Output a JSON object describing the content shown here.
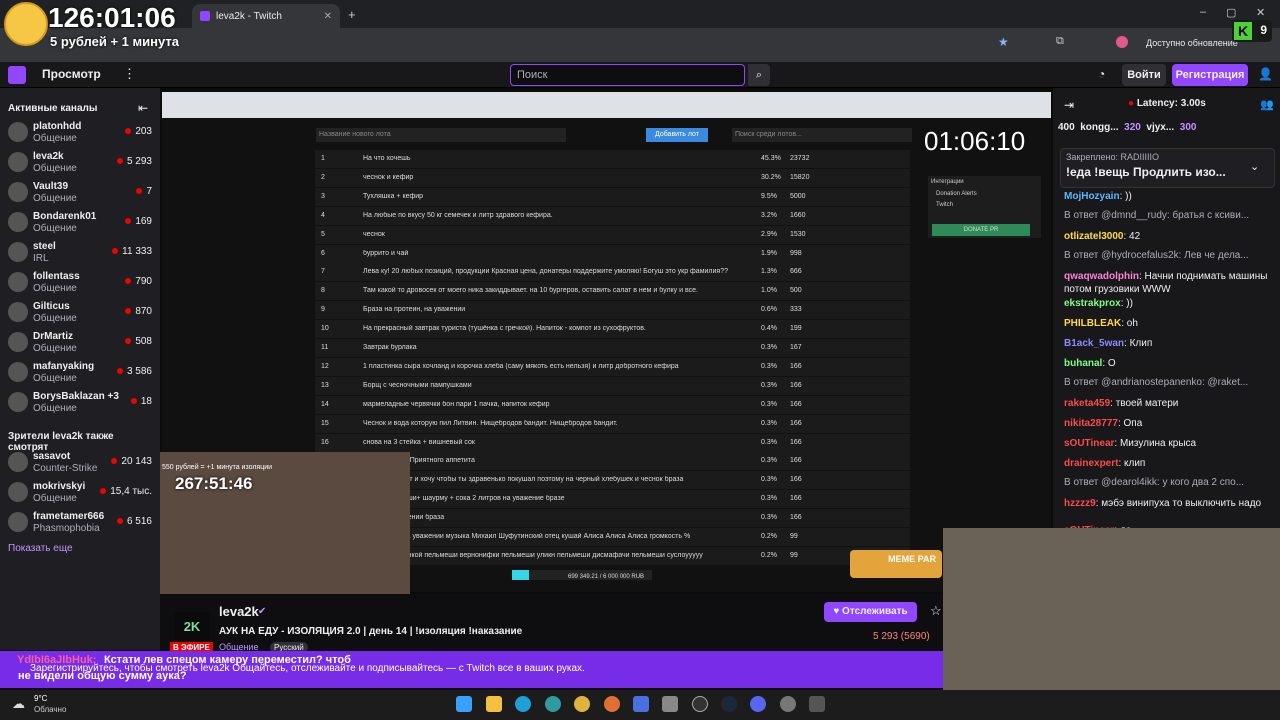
{
  "overlay": {
    "timer": "126:01:06",
    "rubles": "5 рублей + 1 минута"
  },
  "browser": {
    "tab_title": "leva2k - Twitch",
    "update_label": "Доступно обновление"
  },
  "topnav": {
    "browse_label": "Просмотр",
    "search_placeholder": "Поиск",
    "login_label": "Войти",
    "signup_label": "Регистрация"
  },
  "sidebar": {
    "active_header": "Активные каналы",
    "channels": [
      {
        "name": "platonhdd",
        "category": "Общение",
        "viewers": "203"
      },
      {
        "name": "leva2k",
        "category": "Общение",
        "viewers": "5 293"
      },
      {
        "name": "Vault39",
        "category": "Общение",
        "viewers": "7"
      },
      {
        "name": "Bondarenk01",
        "category": "Общение",
        "viewers": "169"
      },
      {
        "name": "steel",
        "category": "IRL",
        "viewers": "11 333"
      },
      {
        "name": "follentass",
        "category": "Общение",
        "viewers": "790"
      },
      {
        "name": "Gilticus",
        "category": "Общение",
        "viewers": "870"
      },
      {
        "name": "DrMartiz",
        "category": "Общение",
        "viewers": "508"
      },
      {
        "name": "mafanyaking",
        "category": "Общение",
        "viewers": "3 586"
      },
      {
        "name": "BorysBaklazan +3",
        "category": "Общение",
        "viewers": "18"
      }
    ],
    "also_header": "Зрители leva2k также смотрят",
    "also": [
      {
        "name": "sasavot",
        "category": "Counter-Strike",
        "viewers": "20 143"
      },
      {
        "name": "mokrivskyi",
        "category": "Общение",
        "viewers": "15,4 тыс."
      },
      {
        "name": "frametamer666",
        "category": "Phasmophobia",
        "viewers": "6 516"
      }
    ],
    "show_more": "Показать еще"
  },
  "stream": {
    "big_timer": "01:06:10",
    "webcam_timer": "267:51:46",
    "webcam_text": "550 рублей = +1 минута изоляции",
    "add_lot": "Добавить лот",
    "new_lot_placeholder": "Название нового лота",
    "search_lot_placeholder": "Поиск среди лотов...",
    "donate_btn": "DONATE PR",
    "integrations": "Интеграции",
    "donation_alerts": "Donation Alerts",
    "twitch": "Twitch",
    "lots": [
      {
        "n": "1",
        "t": "На что хочешь",
        "p": "45.3%",
        "v": "23732"
      },
      {
        "n": "2",
        "t": "чеснок и кефир",
        "p": "30.2%",
        "v": "15820"
      },
      {
        "n": "3",
        "t": "Тухляшка + кефир",
        "p": "9.5%",
        "v": "5000"
      },
      {
        "n": "4",
        "t": "На любые по вкусу 50 кг семечек и литр здравого кефира.",
        "p": "3.2%",
        "v": "1660"
      },
      {
        "n": "5",
        "t": "чеснок",
        "p": "2.9%",
        "v": "1530"
      },
      {
        "n": "6",
        "t": "буррито и чай",
        "p": "1.9%",
        "v": "998"
      },
      {
        "n": "7",
        "t": "Лева ку! 20 любых позиций, продукции Красная цена, донатеры поддержите умоляю! Богуш это укр фамилия??",
        "p": "1.3%",
        "v": "666"
      },
      {
        "n": "8",
        "t": "Там какой то дровосек от моего ника закиддывает. на 10 бургеров, оставить салат в нем и булку и все.",
        "p": "1.0%",
        "v": "500"
      },
      {
        "n": "9",
        "t": "Браза на протеин, на уважении",
        "p": "0.6%",
        "v": "333"
      },
      {
        "n": "10",
        "t": "На прекрасный завтрак туриста (тушёнка с гречкой). Напиток - компот из сухофруктов.",
        "p": "0.4%",
        "v": "199"
      },
      {
        "n": "11",
        "t": "Завтрак бурлака",
        "p": "0.3%",
        "v": "167"
      },
      {
        "n": "12",
        "t": "1 пластинка сыра хочланд и корочка хлеба (саму мякоть есть нельзя) и литр добротного кефира",
        "p": "0.3%",
        "v": "166"
      },
      {
        "n": "13",
        "t": "Борщ с чесночными пампушками",
        "p": "0.3%",
        "v": "166"
      },
      {
        "n": "14",
        "t": "мармеладные червячки бон пари 1 пачка, напиток кефир",
        "p": "0.3%",
        "v": "166"
      },
      {
        "n": "15",
        "t": "Чеснок и вода которую пил Литвин. Нищебродов бандит. Нищебродов бандит.",
        "p": "0.3%",
        "v": "166"
      },
      {
        "n": "16",
        "t": "снова на 3 стейка + вишневый сок",
        "p": "0.3%",
        "v": "166"
      },
      {
        "n": "17",
        "t": "ные огурчики. Приятного аппетита",
        "p": "0.3%",
        "v": "166"
      },
      {
        "n": "18",
        "t": "стенный фанат и хочу чтобы ты здравенько покушал поэтому на черный хлебушек и чеснок браза",
        "p": "0.3%",
        "v": "166"
      },
      {
        "n": "19",
        "t": "на бургер+ суши+ шаурму + сока 2 литров на уважение брaзе",
        "p": "0.3%",
        "v": "166"
      },
      {
        "n": "20",
        "t": "кость на уважении браза",
        "p": "0.3%",
        "v": "166"
      },
      {
        "n": "21",
        "t": "лишу браза на уважении музыка Михаил Шуфутинский отец кушай Алиса Алиса Алиса громкость %",
        "p": "0.2%",
        "v": "99"
      },
      {
        "n": "22",
        "t": "меши с сметанкой пельмеши вернонифки пельмеши уликн пельмеши дисмафачи пельмеши суслоууууу",
        "p": "0.2%",
        "v": "99"
      }
    ],
    "progress_text": "699 349.21 / 6 000 000 RUB",
    "meme_label": "MEME PAR"
  },
  "info": {
    "channel_name": "leva2k",
    "avatar_text": "2K",
    "title": "АУК НА ЕДУ - ИЗОЛЯЦИЯ 2.0 | день 14 | !изоляция !наказание",
    "live_label": "В ЭФИРЕ",
    "category": "Общение",
    "language": "Русский",
    "follow_label": "Отслеживать",
    "viewers": "5 293 (5690)"
  },
  "banner": {
    "user": "YdIbI6aJIbHuk:",
    "message": "Кстати лев спецом камеру переместил? чтоб",
    "message2": "не видели общую сумму аука?",
    "subtitle": "Зарегистрируйтесь, чтобы смотреть leva2k  Общайтесь, отслеживайте и подписывайтесь — с Twitch все в ваших руках."
  },
  "chat": {
    "latency": "Latency: 3.00s",
    "hype": [
      "400",
      "kongg...",
      "320",
      "vjyx...",
      "300"
    ],
    "pinned_label": "Закреплено: RADIIIIIO",
    "pinned_text": "!еда !вещь Продлить изо...",
    "messages": [
      {
        "type": "msg",
        "user": "MojHozyain",
        "color": "#5cb5ff",
        "text": ": ))"
      },
      {
        "type": "reply",
        "text": "В ответ @dmnd__rudy: братья с ксиви..."
      },
      {
        "type": "msg",
        "user": "otlizatel3000",
        "color": "#ffdc4a",
        "text": ": 42"
      },
      {
        "type": "reply",
        "text": "В ответ @hydrocefalus2k: Лев че дела..."
      },
      {
        "type": "msg",
        "user": "qwaqwadolphin",
        "color": "#ff7fd6",
        "text": ": Начни поднимать машины потом грузовики WWW"
      },
      {
        "type": "msg",
        "user": "ekstrakprox",
        "color": "#7fff7f",
        "text": ": ))"
      },
      {
        "type": "msg",
        "user": "PHILBLEAK",
        "color": "#ffd84a",
        "text": ": oh"
      },
      {
        "type": "msg",
        "user": "B1ack_5wan",
        "color": "#8a8aff",
        "text": ": Клип"
      },
      {
        "type": "msg",
        "user": "buhanal",
        "color": "#7fff7f",
        "text": ": О"
      },
      {
        "type": "reply",
        "text": "В ответ @andrianostepanenko: @raket..."
      },
      {
        "type": "msg",
        "user": "raketa459",
        "color": "#ff4a4a",
        "text": ": твоей матери"
      },
      {
        "type": "msg",
        "user": "nikita28777",
        "color": "#ff4a4a",
        "text": ": Опа"
      },
      {
        "type": "msg",
        "user": "sOUTinear",
        "color": "#ff4a4a",
        "text": ": Мизулина крыса"
      },
      {
        "type": "msg",
        "user": "drainexpert",
        "color": "#ff4a4a",
        "text": ": клип"
      },
      {
        "type": "reply",
        "text": "В ответ @dearol4ikk: у кого два 2 спо..."
      },
      {
        "type": "msg",
        "user": "hzzzz9",
        "color": "#ff4a4a",
        "text": ": мэбэ винипуха то выключить надо"
      },
      {
        "type": "msg",
        "user": "sOUTinear",
        "color": "#ff4a4a",
        "text": ": да"
      }
    ]
  },
  "taskbar": {
    "temp": "9°C",
    "weather": "Облачно"
  },
  "kbadge": {
    "letter": "K",
    "count": "9"
  }
}
